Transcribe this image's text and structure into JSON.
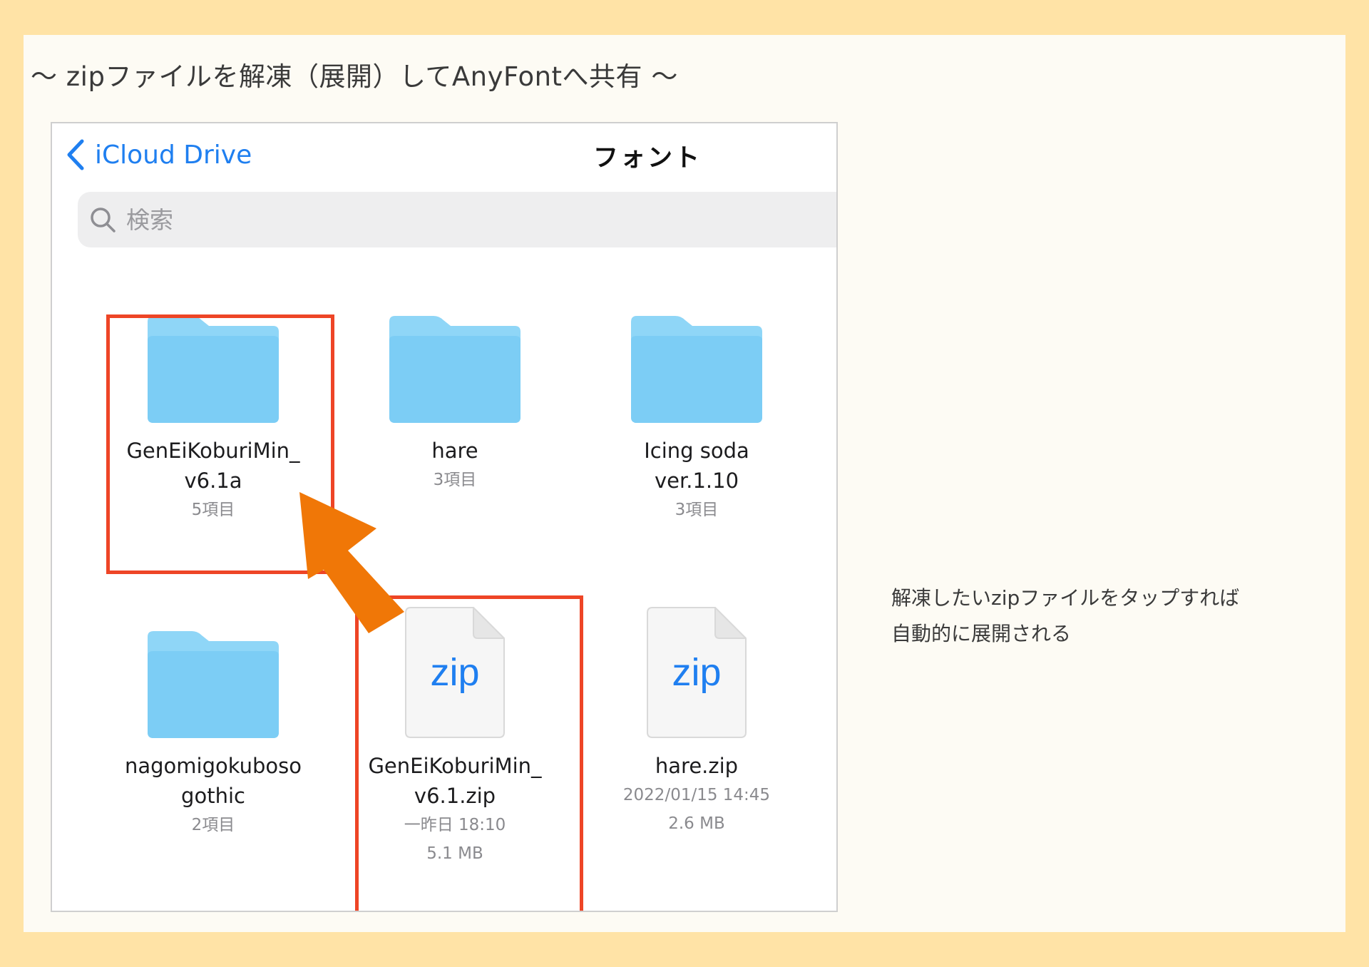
{
  "heading": "〜 zipファイルを解凍（展開）してAnyFontへ共有 〜",
  "nav": {
    "back_label": "iCloud Drive",
    "title": "フォント"
  },
  "search": {
    "placeholder": "検索",
    "value": ""
  },
  "items": [
    {
      "name_line1": "GenEiKoburiMin_",
      "name_line2": "v6.1a",
      "meta1": "5項目",
      "meta2": ""
    },
    {
      "name_line1": "hare",
      "name_line2": "",
      "meta1": "3項目",
      "meta2": ""
    },
    {
      "name_line1": "Icing soda",
      "name_line2": "ver.1.10",
      "meta1": "3項目",
      "meta2": ""
    },
    {
      "name_line1": "nagomigokuboso",
      "name_line2": "gothic",
      "meta1": "2項目",
      "meta2": ""
    },
    {
      "name_line1": "GenEiKoburiMin_",
      "name_line2": "v6.1.zip",
      "meta1": "一昨日 18:10",
      "meta2": "5.1 MB",
      "file_label": "zip"
    },
    {
      "name_line1": "hare.zip",
      "name_line2": "",
      "meta1": "2022/01/15 14:45",
      "meta2": "2.6 MB",
      "file_label": "zip"
    }
  ],
  "note": {
    "line1": "解凍したいzipファイルをタップすれば",
    "line2": "自動的に展開される"
  },
  "colors": {
    "background": "#ffe3a6",
    "panel": "#fdfbf4",
    "accent_blue": "#1f7ff0",
    "highlight_red": "#ee4526",
    "arrow_orange": "#f07707",
    "folder_blue": "#7fd0f6"
  },
  "icons": {
    "back": "chevron-left-icon",
    "search": "magnifier-icon",
    "folder": "folder-icon",
    "zip_file": "zip-file-icon",
    "pointer": "arrow-icon"
  }
}
